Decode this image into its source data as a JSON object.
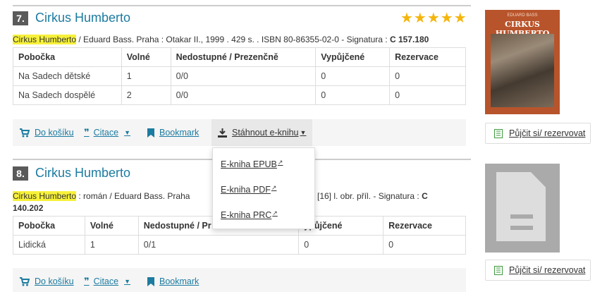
{
  "records": [
    {
      "number": "7.",
      "title": "Cirkus Humberto",
      "rating_stars": "★★★★★",
      "rating": 4.5,
      "bib_highlight": "Cirkus Humberto",
      "bib_rest": " / Eduard Bass.   Praha : Otakar II., 1999 . 429 s. . ISBN 80-86355-02-0 - Signatura : ",
      "bib_signature": "C 157.180",
      "holdings": {
        "headers": [
          "Pobočka",
          "Volné",
          "Nedostupné / Prezenčně",
          "Vypůjčené",
          "Rezervace"
        ],
        "rows": [
          [
            "Na Sadech dětské",
            "1",
            "0/0",
            "0",
            "0"
          ],
          [
            "Na Sadech dospělé",
            "2",
            "0/0",
            "0",
            "0"
          ]
        ]
      },
      "actions": {
        "cart": "Do košíku",
        "cite": "Citace",
        "bookmark": "Bookmark",
        "download": "Stáhnout e-knihu"
      },
      "cover_title": "CIRKUS HUMBERTO",
      "reserve": "Půjčit si/ rezervovat"
    },
    {
      "number": "8.",
      "title": "Cirkus Humberto",
      "bib_highlight": "Cirkus Humberto",
      "bib_rest": " : román / Eduard Bass.   Praha",
      "bib_rest2": "[16] l. obr. příl. - Signatura : ",
      "bib_signature_a": "C",
      "bib_signature_b": "140.202",
      "holdings": {
        "headers": [
          "Pobočka",
          "Volné",
          "Nedostupné / Pr",
          "ypůjčené",
          "Rezervace"
        ],
        "rows": [
          [
            "Lidická",
            "1",
            "0/1",
            "0",
            "0"
          ]
        ]
      },
      "actions": {
        "cart": "Do košíku",
        "cite": "Citace",
        "bookmark": "Bookmark"
      },
      "reserve": "Půjčit si/ rezervovat"
    }
  ],
  "download_menu": {
    "items": [
      "E-kniha EPUB",
      "E-kniha PDF",
      "E-kniha PRC"
    ]
  },
  "colors": {
    "link": "#1c7ba0",
    "highlight": "#f7f13a",
    "stars": "#f4b50c",
    "reserve_icon": "#3c9a3c"
  }
}
